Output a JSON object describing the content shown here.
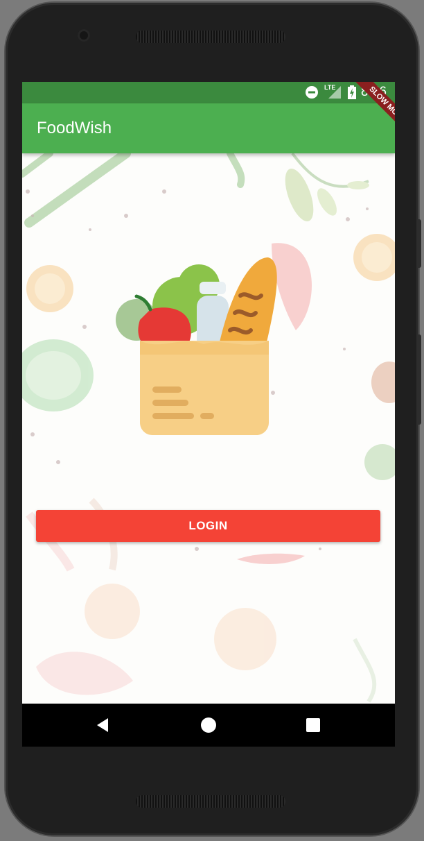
{
  "status_bar": {
    "time": "8:56",
    "network_label": "LTE",
    "icons": [
      "do-not-disturb-icon",
      "lte-icon",
      "signal-icon",
      "battery-charging-icon"
    ]
  },
  "app_bar": {
    "title": "FoodWish",
    "debug_banner": "SLOW MODE"
  },
  "main": {
    "illustration": "grocery-bag-icon",
    "login_label": "LOGIN"
  },
  "nav_bar": {
    "icons": [
      "back-icon",
      "home-icon",
      "recents-icon"
    ]
  },
  "colors": {
    "status_bar": "#3b8a3e",
    "app_bar": "#4caf50",
    "login_button": "#f44336",
    "background": "#fdfdfb"
  }
}
